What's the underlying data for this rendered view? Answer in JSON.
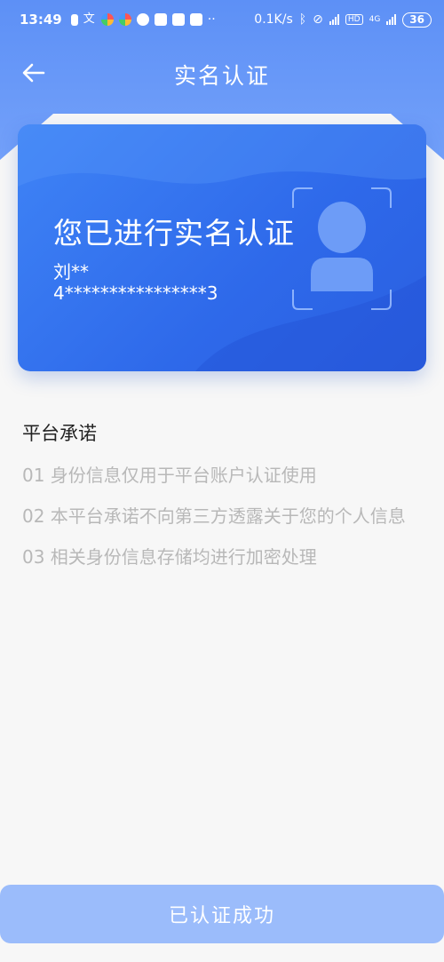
{
  "status_bar": {
    "time": "13:49",
    "network_speed": "0.1K/s",
    "network_type": "4G",
    "hd_badge": "HD",
    "battery": "36"
  },
  "nav": {
    "title": "实名认证"
  },
  "card": {
    "title": "您已进行实名认证",
    "name": "刘**",
    "id_number": "4****************3"
  },
  "promise": {
    "title": "平台承诺",
    "items": [
      "01 身份信息仅用于平台账户认证使用",
      "02 本平台承诺不向第三方透露关于您的个人信息",
      "03 相关身份信息存储均进行加密处理"
    ]
  },
  "button": {
    "label": "已认证成功"
  },
  "colors": {
    "header_blue": "#5d90f6",
    "card_blue": "#2e69ea",
    "button_blue": "#9bbcfb"
  }
}
